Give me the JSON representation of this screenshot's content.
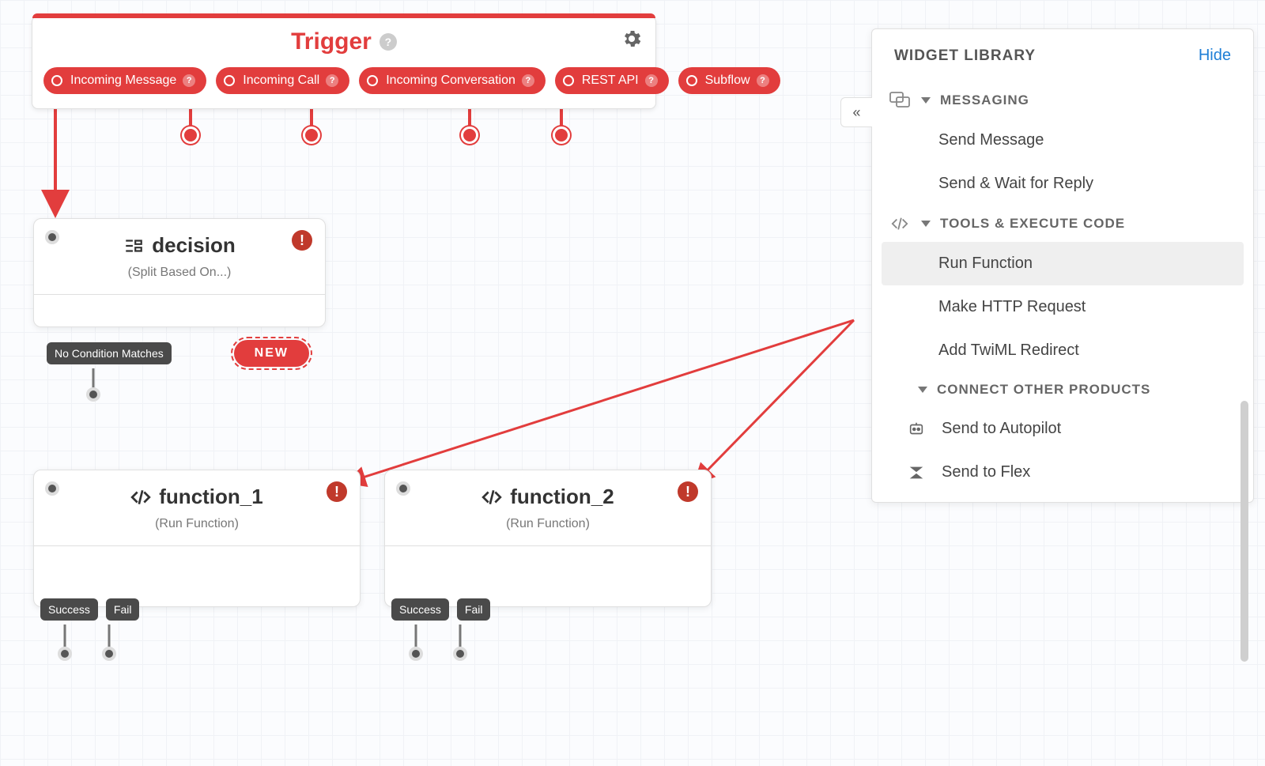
{
  "trigger": {
    "title": "Trigger",
    "pills": [
      {
        "label": "Incoming Message"
      },
      {
        "label": "Incoming Call"
      },
      {
        "label": "Incoming Conversation"
      },
      {
        "label": "REST API"
      },
      {
        "label": "Subflow"
      }
    ]
  },
  "decision": {
    "title": "decision",
    "subtitle": "(Split Based On...)",
    "noMatch": "No Condition Matches",
    "newLabel": "NEW"
  },
  "functions": [
    {
      "title": "function_1",
      "subtitle": "(Run Function)",
      "outs": [
        "Success",
        "Fail"
      ]
    },
    {
      "title": "function_2",
      "subtitle": "(Run Function)",
      "outs": [
        "Success",
        "Fail"
      ]
    }
  ],
  "sidebar": {
    "heading": "WIDGET LIBRARY",
    "hide": "Hide",
    "collapse": "«",
    "groups": [
      {
        "icon": "chat",
        "label": "MESSAGING",
        "items": [
          {
            "label": "Send Message"
          },
          {
            "label": "Send & Wait for Reply"
          }
        ]
      },
      {
        "icon": "code",
        "label": "TOOLS & EXECUTE CODE",
        "items": [
          {
            "label": "Run Function",
            "selected": true
          },
          {
            "label": "Make HTTP Request"
          },
          {
            "label": "Add TwiML Redirect"
          }
        ]
      },
      {
        "icon": "none",
        "label": "CONNECT OTHER PRODUCTS",
        "indent": true,
        "items": [
          {
            "label": "Send to Autopilot",
            "icon": "autopilot"
          },
          {
            "label": "Send to Flex",
            "icon": "flex"
          }
        ]
      }
    ]
  }
}
